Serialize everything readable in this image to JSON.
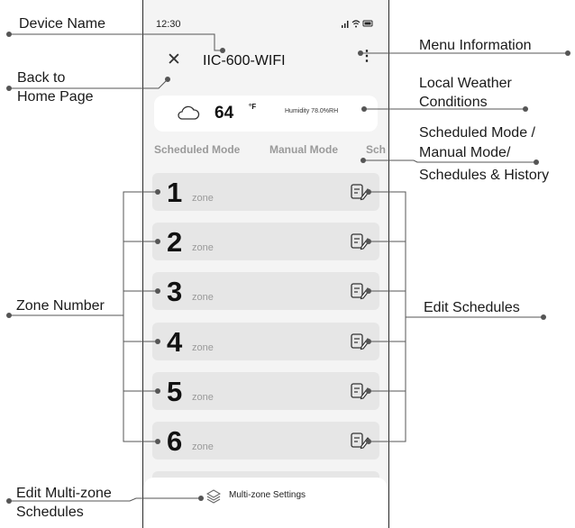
{
  "callouts": {
    "device_name": "Device Name",
    "back_line1": "Back to",
    "back_line2": "Home Page",
    "zone_number": "Zone Number",
    "edit_multi_line1": "Edit Multi-zone",
    "edit_multi_line2": "Schedules",
    "menu_info": "Menu Information",
    "weather_line1": "Local Weather",
    "weather_line2": "Conditions",
    "mode_line1": "Scheduled Mode /",
    "mode_line2": "Manual Mode/",
    "mode_line3": "Schedules & History",
    "edit_schedules": "Edit Schedules"
  },
  "status": {
    "time": "12:30",
    "icons": "signal-wifi-battery"
  },
  "header": {
    "title": "IIC-600-WIFI",
    "close_icon": "close-icon",
    "menu_icon": "more-vertical-icon"
  },
  "weather": {
    "temp": "64",
    "unit": "°F",
    "humidity": "Humidity 78.0%RH",
    "icon": "cloud-icon"
  },
  "tabs": [
    "Scheduled Mode",
    "Manual Mode",
    "Sch"
  ],
  "zones": [
    {
      "number": "1",
      "label": "zone"
    },
    {
      "number": "2",
      "label": "zone"
    },
    {
      "number": "3",
      "label": "zone"
    },
    {
      "number": "4",
      "label": "zone"
    },
    {
      "number": "5",
      "label": "zone"
    },
    {
      "number": "6",
      "label": "zone"
    }
  ],
  "bottom": {
    "label": "Multi-zone Settings",
    "icon": "layers-icon"
  },
  "colors": {
    "phone_bg": "#f4f4f4",
    "zone_bg": "#e6e6e6",
    "line": "#555555"
  }
}
